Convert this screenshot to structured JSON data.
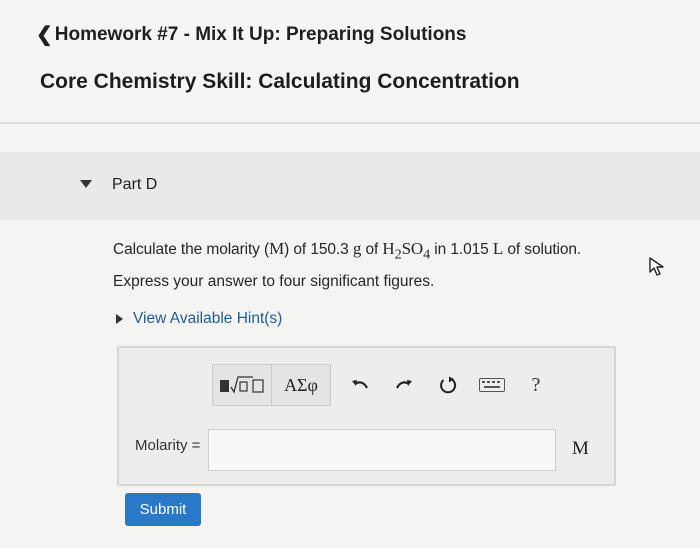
{
  "header": {
    "back_link": "Homework #7 - Mix It Up: Preparing Solutions",
    "page_title": "Core Chemistry Skill: Calculating Concentration"
  },
  "part": {
    "label": "Part D"
  },
  "question": {
    "text_1": "Calculate the molarity (",
    "molarity_symbol": "M",
    "text_2": ") of 150.3 ",
    "gram_unit": "g",
    "text_3": " of ",
    "formula_h": "H",
    "formula_h_sub": "2",
    "formula_so": "SO",
    "formula_so_sub": "4",
    "text_4": " in 1.015 ",
    "liter_unit": "L",
    "text_5": " of solution."
  },
  "instruction": "Express your answer to four significant figures.",
  "hint_link": "View Available Hint(s)",
  "toolbar": {
    "symbols_label": "ΑΣφ",
    "help_label": "?"
  },
  "answer": {
    "label": "Molarity =",
    "value": "",
    "unit": "M"
  },
  "submit_label": "Submit",
  "colors": {
    "accent": "#2a79c9",
    "link": "#1f5d93"
  }
}
